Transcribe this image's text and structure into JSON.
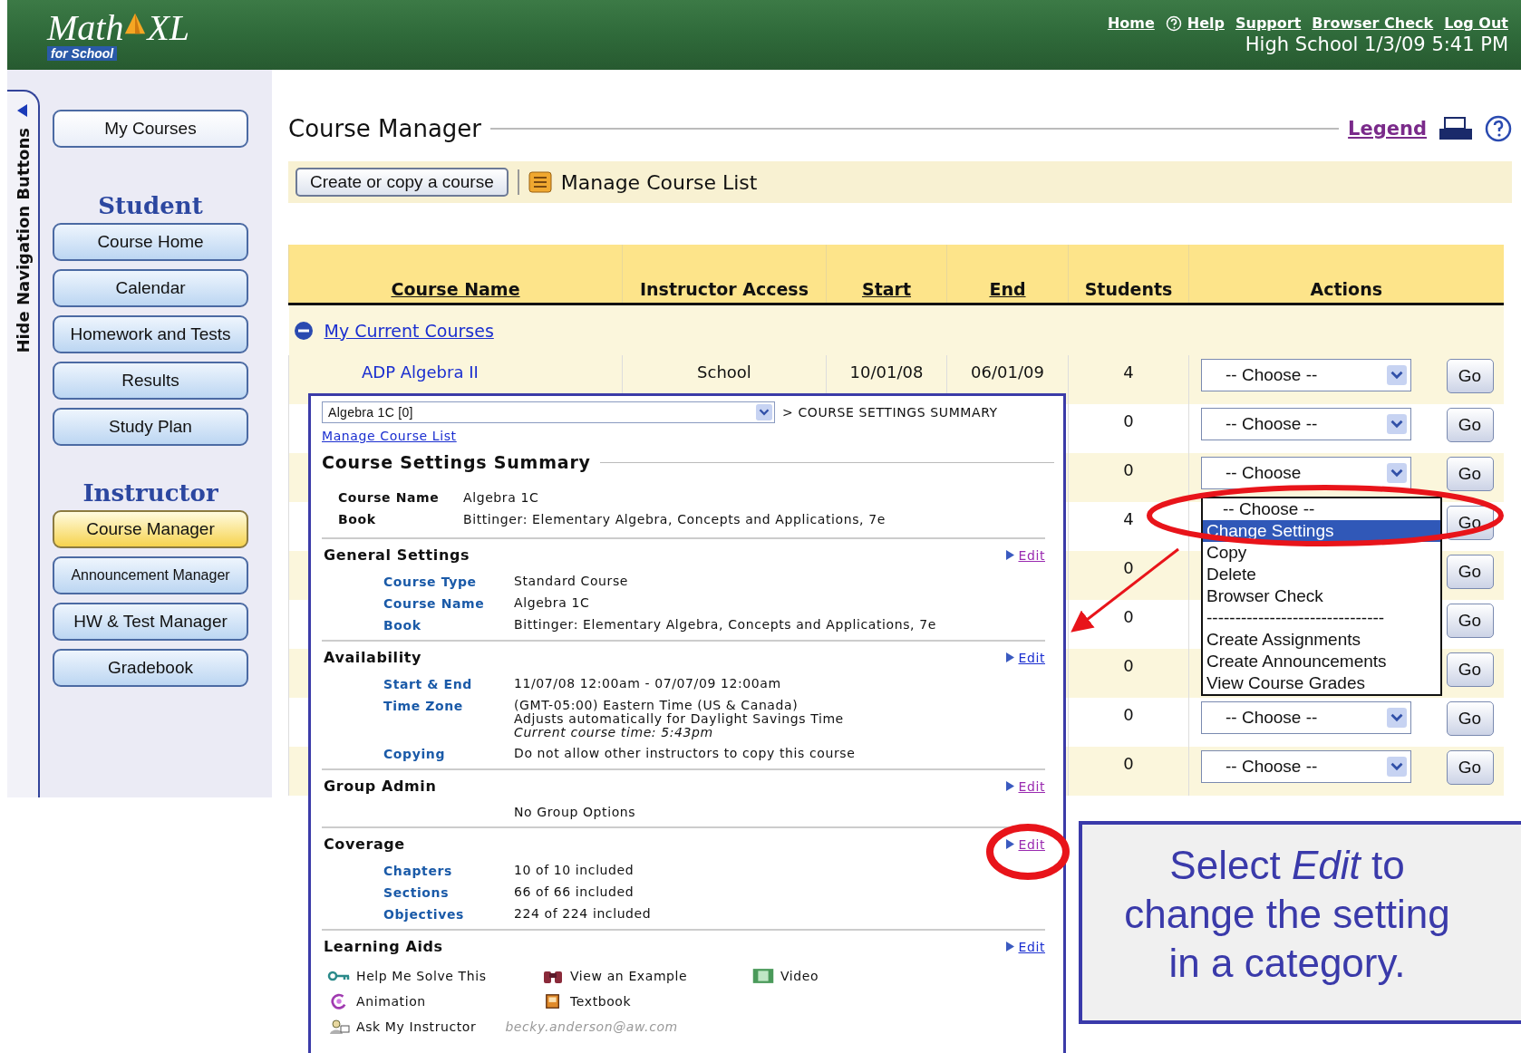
{
  "header": {
    "logo": {
      "word": "Math",
      "suffix": "XL",
      "tagline": "for School"
    },
    "links": [
      {
        "label": "Home",
        "kind": "link"
      },
      {
        "label": "Help",
        "kind": "help"
      },
      {
        "label": "Support",
        "kind": "link"
      },
      {
        "label": "Browser Check",
        "kind": "link"
      },
      {
        "label": "Log Out",
        "kind": "link"
      }
    ],
    "info": "High School 1/3/09 5:41 PM"
  },
  "sidebar": {
    "toggle": "Hide Navigation Buttons",
    "groups": [
      {
        "items": [
          {
            "label": "My Courses",
            "selected": false
          }
        ]
      },
      {
        "heading": "Student",
        "items": [
          {
            "label": "Course Home",
            "selected": false
          },
          {
            "label": "Calendar",
            "selected": false
          },
          {
            "label": "Homework and Tests",
            "selected": false
          },
          {
            "label": "Results",
            "selected": false
          },
          {
            "label": "Study Plan",
            "selected": false
          }
        ]
      },
      {
        "heading": "Instructor",
        "items": [
          {
            "label": "Course Manager",
            "selected": true
          },
          {
            "label": "Announcement Manager",
            "selected": false
          },
          {
            "label": "HW & Test Manager",
            "selected": false
          },
          {
            "label": "Gradebook",
            "selected": false
          }
        ]
      }
    ]
  },
  "page": {
    "title": "Course Manager",
    "legend": "Legend",
    "toolbar": {
      "button": "Create or copy a course",
      "link": "Manage Course List"
    }
  },
  "table": {
    "columns": [
      {
        "label": "Course Name",
        "sortable": true
      },
      {
        "label": "Instructor Access",
        "sortable": false
      },
      {
        "label": "Start",
        "sortable": true
      },
      {
        "label": "End",
        "sortable": true
      },
      {
        "label": "Students",
        "sortable": false
      },
      {
        "label": "Actions",
        "sortable": false
      }
    ],
    "group": {
      "label": "My Current Courses",
      "expanded": true
    },
    "rows": [
      {
        "course_name": "ADP Algebra II",
        "instructor_access": "School",
        "start": "10/01/08",
        "end": "06/01/09",
        "students": "4",
        "action": "-- Choose --",
        "go": "Go"
      },
      {
        "students": "0",
        "action": "-- Choose --",
        "go": "Go"
      },
      {
        "students": "0",
        "action": "-- Choose",
        "go": "Go"
      },
      {
        "students": "4",
        "go": "Go"
      },
      {
        "students": "0",
        "go": "Go"
      },
      {
        "students": "0",
        "go": "Go"
      },
      {
        "students": "0",
        "go": "Go"
      },
      {
        "students": "0",
        "action": "-- Choose --",
        "go": "Go"
      },
      {
        "students": "0",
        "action": "-- Choose --",
        "go": "Go"
      }
    ]
  },
  "dropdown": {
    "options": [
      {
        "label": "-- Choose --",
        "kind": "option",
        "selected": false
      },
      {
        "label": "Change Settings",
        "kind": "option",
        "selected": true
      },
      {
        "label": "Copy",
        "kind": "option",
        "selected": false
      },
      {
        "label": "Delete",
        "kind": "option",
        "selected": false
      },
      {
        "label": "Browser Check",
        "kind": "option",
        "selected": false
      },
      {
        "label": "-------------------------------",
        "kind": "separator"
      },
      {
        "label": "Create Assignments",
        "kind": "option",
        "selected": false
      },
      {
        "label": "Create Announcements",
        "kind": "option",
        "selected": false
      },
      {
        "label": "View Course Grades",
        "kind": "option",
        "selected": false
      }
    ]
  },
  "settings_panel": {
    "course_select": "Algebra 1C [0]",
    "breadcrumb": "> COURSE SETTINGS SUMMARY",
    "link": "Manage Course List",
    "title": "Course Settings Summary",
    "summary": [
      {
        "label": "Course Name",
        "value": "Algebra 1C"
      },
      {
        "label": "Book",
        "value": "Bittinger: Elementary Algebra, Concepts and Applications, 7e"
      }
    ],
    "sections": [
      {
        "title": "General Settings",
        "edit": "Edit",
        "visited": true,
        "rows": [
          {
            "label": "Course Type",
            "lines": [
              "Standard Course"
            ]
          },
          {
            "label": "Course Name",
            "lines": [
              "Algebra 1C"
            ]
          },
          {
            "label": "Book",
            "lines": [
              "Bittinger: Elementary Algebra, Concepts and Applications, 7e"
            ]
          }
        ]
      },
      {
        "title": "Availability",
        "edit": "Edit",
        "visited": false,
        "rows": [
          {
            "label": "Start & End",
            "lines": [
              "11/07/08 12:00am - 07/07/09 12:00am"
            ]
          },
          {
            "label": "Time Zone",
            "lines": [
              "(GMT-05:00) Eastern Time (US & Canada)",
              "Adjusts automatically for Daylight Savings Time"
            ],
            "note": "Current course time: 5:43pm"
          },
          {
            "label": "Copying",
            "lines": [
              "Do not allow other instructors to copy this course"
            ]
          }
        ]
      },
      {
        "title": "Group Admin",
        "edit": "Edit",
        "visited": true,
        "rows": [
          {
            "lines": [
              "No Group Options"
            ]
          }
        ]
      },
      {
        "title": "Coverage",
        "edit": "Edit",
        "visited": true,
        "rows": [
          {
            "label": "Chapters",
            "lines": [
              "10 of 10 included"
            ]
          },
          {
            "label": "Sections",
            "lines": [
              "66 of 66 included"
            ]
          },
          {
            "label": "Objectives",
            "lines": [
              "224 of 224 included"
            ]
          }
        ]
      },
      {
        "title": "Learning Aids",
        "edit": "Edit",
        "visited": false,
        "aid_rows": [
          [
            {
              "label": "Help Me Solve This",
              "kind": "key"
            },
            {
              "label": "View an Example",
              "kind": "binoculars"
            },
            {
              "label": "Video",
              "kind": "film"
            }
          ],
          [
            {
              "label": "Animation",
              "kind": "swirl"
            },
            {
              "label": "Textbook",
              "kind": "book"
            }
          ],
          [
            {
              "label": "Ask My Instructor",
              "kind": "person",
              "email": "becky.anderson@aw.com"
            }
          ]
        ]
      }
    ]
  },
  "callout": {
    "text": "Select *Edit* to change the setting in a category."
  }
}
